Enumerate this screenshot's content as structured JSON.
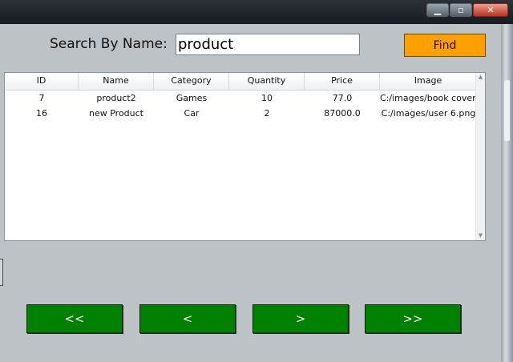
{
  "search": {
    "label": "Search By Name:",
    "value": "product",
    "find_label": "Find"
  },
  "table": {
    "columns": [
      "ID",
      "Name",
      "Category",
      "Quantity",
      "Price",
      "Image"
    ],
    "rows": [
      [
        "7",
        "product2",
        "Games",
        "10",
        "77.0",
        "C:/images/book covers u"
      ],
      [
        "16",
        "new Product",
        "Car",
        "2",
        "87000.0",
        "C:/images/user 6.png"
      ]
    ]
  },
  "pager": {
    "first_label": "<<",
    "prev_label": "<",
    "next_label": ">",
    "last_label": ">>"
  },
  "colors": {
    "find_button": "#ffa000",
    "pager_button": "#008000",
    "window_background": "#bcc2c6"
  },
  "icons": {
    "window_controls": [
      "minimize-icon",
      "maximize-icon",
      "close-icon"
    ],
    "scroll": [
      "scroll-up-icon",
      "scroll-down-icon"
    ]
  }
}
